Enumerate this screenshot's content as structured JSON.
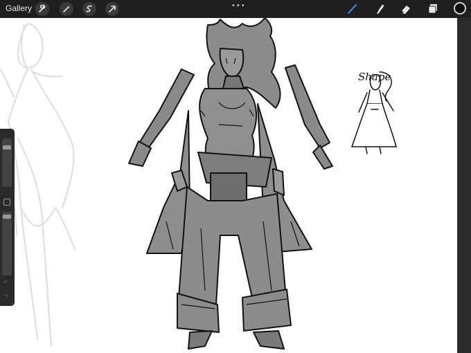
{
  "topbar": {
    "gallery_label": "Gallery",
    "handle": "•••",
    "actions": [
      {
        "name": "wrench-icon"
      },
      {
        "name": "magic-wand-icon"
      },
      {
        "name": "selection-icon"
      },
      {
        "name": "transform-arrow-icon"
      }
    ],
    "tools": [
      {
        "name": "brush-icon",
        "active": true,
        "color": "#2f7fe0"
      },
      {
        "name": "smudge-icon",
        "active": false
      },
      {
        "name": "eraser-icon",
        "active": false
      },
      {
        "name": "layers-icon",
        "active": false
      }
    ],
    "current_color": "#111111"
  },
  "canvas": {
    "annotation": "Shape",
    "background": "#ffffff"
  },
  "sidebar": {
    "brush_size_level": 0.15,
    "opacity_level": 0.05
  }
}
